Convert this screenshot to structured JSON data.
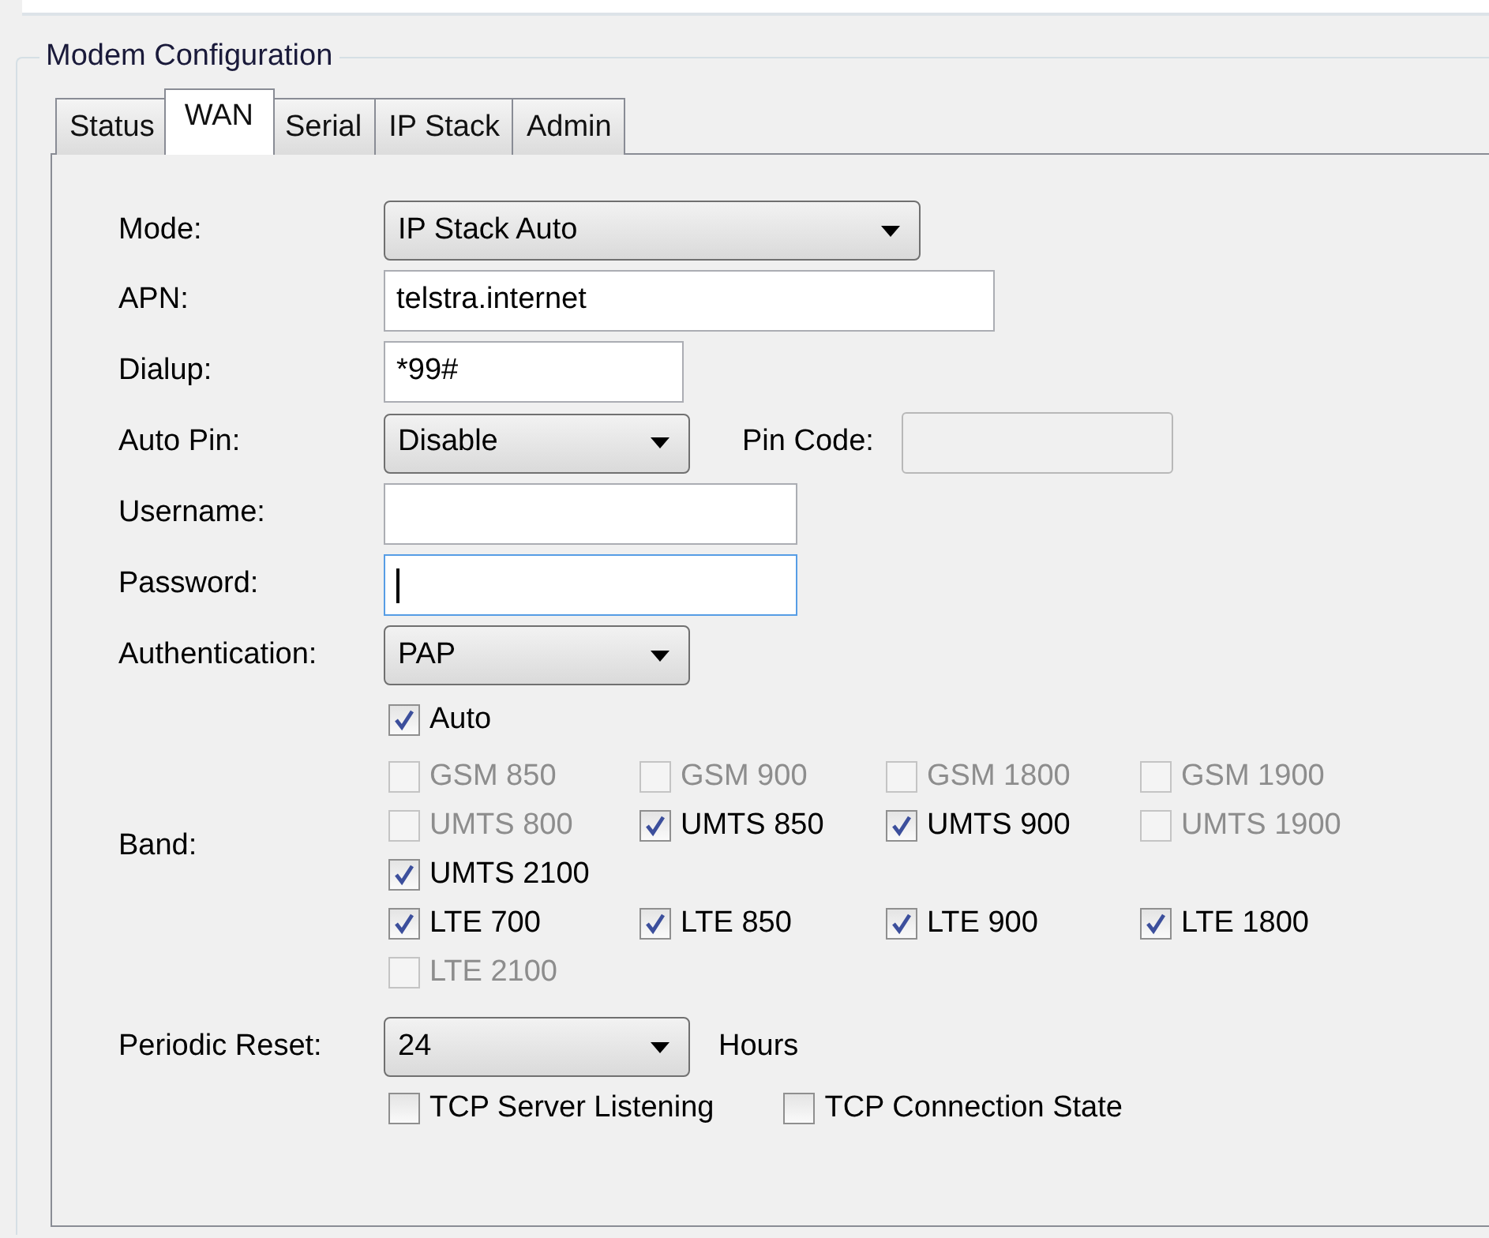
{
  "group_title": "Modem Configuration",
  "tabs": [
    {
      "label": "Status",
      "selected": false
    },
    {
      "label": "WAN",
      "selected": true
    },
    {
      "label": "Serial",
      "selected": false
    },
    {
      "label": "IP Stack",
      "selected": false
    },
    {
      "label": "Admin",
      "selected": false
    }
  ],
  "fields": [
    {
      "kind": "select",
      "label": "Mode:",
      "value": "IP Stack Auto"
    },
    {
      "kind": "text",
      "label": "APN:",
      "value": "telstra.internet"
    },
    {
      "kind": "text",
      "label": "Dialup:",
      "value": "*99#"
    },
    {
      "kind": "select",
      "label": "Auto Pin:",
      "value": "Disable",
      "pin_code": {
        "label": "Pin Code:",
        "disabled": true
      }
    },
    {
      "kind": "text",
      "label": "Username:"
    },
    {
      "kind": "text",
      "label": "Password:",
      "focused": true
    },
    {
      "kind": "select",
      "label": "Authentication:",
      "value": "PAP"
    }
  ],
  "band": {
    "label": "Band:",
    "auto": {
      "label": "Auto",
      "checked": true,
      "disabled": false
    },
    "rows": [
      {
        "options": [
          {
            "label": "GSM 850",
            "checked": false,
            "disabled": true
          },
          {
            "label": "GSM 900",
            "checked": false,
            "disabled": true
          },
          {
            "label": "GSM 1800",
            "checked": false,
            "disabled": true
          },
          {
            "label": "GSM 1900",
            "checked": false,
            "disabled": true
          }
        ]
      },
      {
        "options": [
          {
            "label": "UMTS 800",
            "checked": false,
            "disabled": true
          },
          {
            "label": "UMTS 850",
            "checked": true,
            "disabled": false
          },
          {
            "label": "UMTS 900",
            "checked": true,
            "disabled": false
          },
          {
            "label": "UMTS 1900",
            "checked": false,
            "disabled": true
          }
        ]
      },
      {
        "options": [
          {
            "label": "UMTS 2100",
            "checked": true,
            "disabled": false
          }
        ]
      },
      {
        "options": [
          {
            "label": "LTE 700",
            "checked": true,
            "disabled": false
          },
          {
            "label": "LTE 850",
            "checked": true,
            "disabled": false
          },
          {
            "label": "LTE 900",
            "checked": true,
            "disabled": false
          },
          {
            "label": "LTE 1800",
            "checked": true,
            "disabled": false
          }
        ]
      },
      {
        "options": [
          {
            "label": "LTE 2100",
            "checked": false,
            "disabled": true
          }
        ]
      }
    ]
  },
  "periodic_reset": {
    "label": "Periodic Reset:",
    "value": "24",
    "unit": "Hours"
  },
  "tcp_options": [
    {
      "label": "TCP Server Listening",
      "checked": false,
      "disabled": false
    },
    {
      "label": "TCP Connection State",
      "checked": false,
      "disabled": false
    }
  ]
}
